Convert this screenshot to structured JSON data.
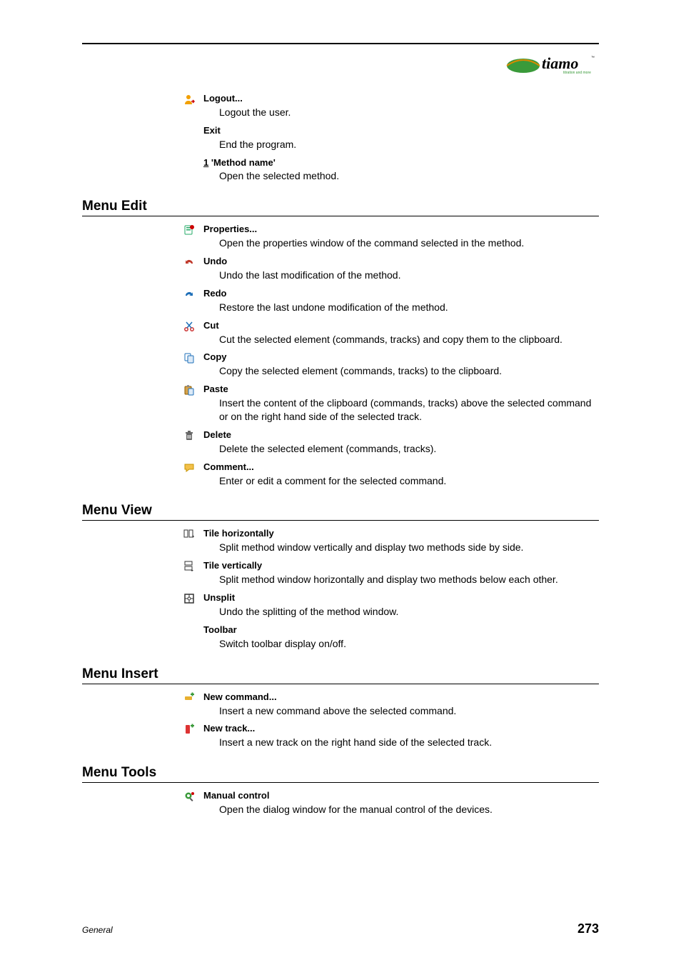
{
  "logo": {
    "brand": "tiamo",
    "tagline": "titration and more"
  },
  "preItems": [
    {
      "icon": "logout-icon",
      "title": "Logout...",
      "desc": "Logout the user."
    },
    {
      "icon": null,
      "title": "Exit",
      "desc": "End the program."
    },
    {
      "icon": null,
      "titlePrefixUnderline": "1",
      "titleRest": " 'Method name'",
      "desc": "Open the selected method."
    }
  ],
  "sections": [
    {
      "heading": "Menu Edit",
      "items": [
        {
          "icon": "properties-icon",
          "title": "Properties...",
          "desc": "Open the properties window of the command selected in the method."
        },
        {
          "icon": "undo-icon",
          "title": "Undo",
          "desc": "Undo the last modification of the method."
        },
        {
          "icon": "redo-icon",
          "title": "Redo",
          "desc": "Restore the last undone modification of the method."
        },
        {
          "icon": "cut-icon",
          "title": "Cut",
          "desc": "Cut the selected element (commands, tracks) and copy them to the clipboard."
        },
        {
          "icon": "copy-icon",
          "title": "Copy",
          "desc": "Copy the selected element (commands, tracks) to the clipboard."
        },
        {
          "icon": "paste-icon",
          "title": "Paste",
          "desc": "Insert the content of the clipboard (commands, tracks) above the selected command or on the right hand side of the selected track."
        },
        {
          "icon": "delete-icon",
          "title": "Delete",
          "desc": "Delete the selected element (commands, tracks)."
        },
        {
          "icon": "comment-icon",
          "title": "Comment...",
          "desc": "Enter or edit a comment for the selected command."
        }
      ]
    },
    {
      "heading": "Menu View",
      "items": [
        {
          "icon": "tile-horizontal-icon",
          "title": "Tile horizontally",
          "desc": "Split method window vertically and display two methods side by side."
        },
        {
          "icon": "tile-vertical-icon",
          "title": "Tile vertically",
          "desc": "Split method window horizontally and display two methods below each other."
        },
        {
          "icon": "unsplit-icon",
          "title": "Unsplit",
          "desc": "Undo the splitting of the method window."
        },
        {
          "icon": null,
          "title": "Toolbar",
          "desc": "Switch toolbar display on/off."
        }
      ]
    },
    {
      "heading": "Menu Insert",
      "items": [
        {
          "icon": "new-command-icon",
          "title": "New command...",
          "desc": "Insert a new command above the selected command."
        },
        {
          "icon": "new-track-icon",
          "title": "New track...",
          "desc": "Insert a new track on the right hand side of the selected track."
        }
      ]
    },
    {
      "heading": "Menu Tools",
      "items": [
        {
          "icon": "manual-control-icon",
          "title": "Manual control",
          "desc": "Open the dialog window for the manual control of the devices."
        }
      ]
    }
  ],
  "footer": {
    "left": "General",
    "right": "273"
  }
}
